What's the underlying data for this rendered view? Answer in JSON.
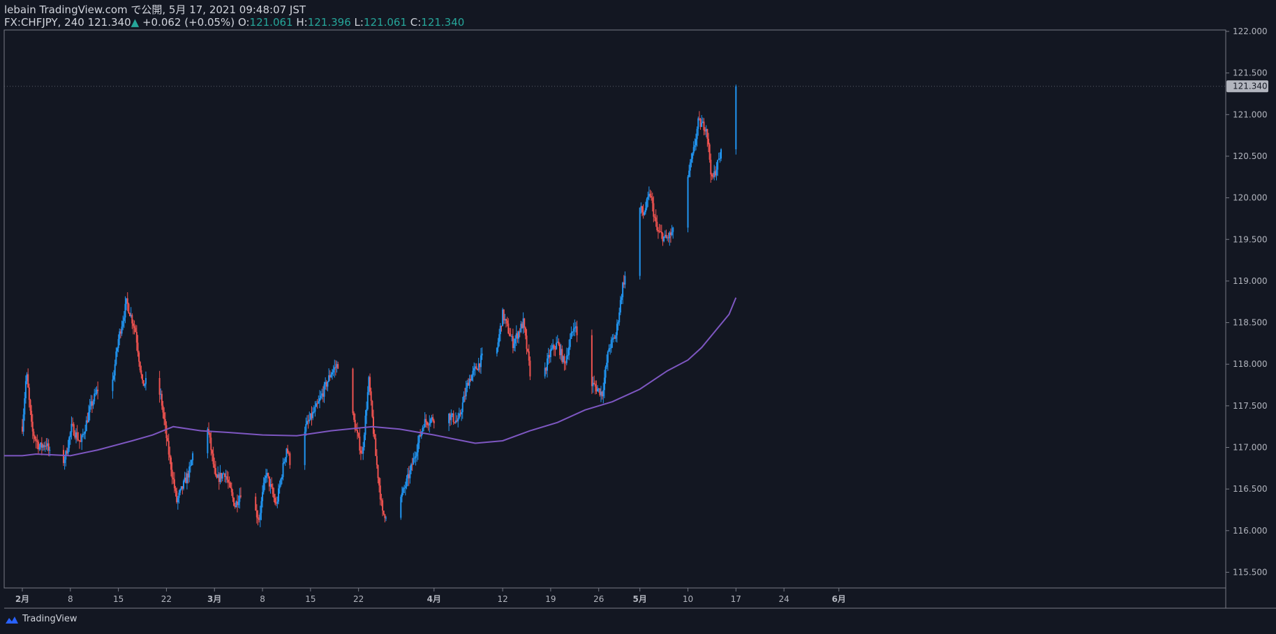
{
  "header": {
    "publish_line": "lebain TradingView.com で公開, 5月 17, 2021 09:48:07 JST",
    "symbol": "FX:CHFJPY, 240",
    "last": "121.340",
    "arrow": "▲",
    "change": "+0.062 (+0.05%)",
    "o_label": "O:",
    "o_value": "121.061",
    "h_label": "H:",
    "h_value": "121.396",
    "l_label": "L:",
    "l_value": "121.061",
    "c_label": "C:",
    "c_value": "121.340"
  },
  "footer": {
    "brand": "TradingView"
  },
  "colors": {
    "background": "#131722",
    "up": "#2196f3",
    "down": "#ef5350",
    "ma": "#7e57c2",
    "axis_text": "#b2b5be",
    "border": "#787b86",
    "price_tag_bg": "#b2b5be"
  },
  "chart_data": {
    "type": "candlestick",
    "symbol": "FX:CHFJPY",
    "interval": "240",
    "ylim": [
      115.35,
      122.1
    ],
    "price_ticks": [
      115.5,
      116.0,
      116.5,
      117.0,
      117.5,
      118.0,
      118.5,
      119.0,
      119.5,
      120.0,
      120.5,
      121.0,
      121.5,
      122.0
    ],
    "price_tick_labels": [
      "115.500",
      "116.000",
      "116.500",
      "117.000",
      "117.500",
      "118.000",
      "118.500",
      "119.000",
      "119.500",
      "120.000",
      "120.500",
      "121.000",
      "121.500",
      "122.000"
    ],
    "current_price": 121.34,
    "current_price_label": "121.340",
    "x_ticks": [
      {
        "label": "2月",
        "day": 0,
        "bold": true
      },
      {
        "label": "8",
        "day": 7
      },
      {
        "label": "15",
        "day": 14
      },
      {
        "label": "22",
        "day": 21
      },
      {
        "label": "3月",
        "day": 28,
        "bold": true
      },
      {
        "label": "8",
        "day": 35
      },
      {
        "label": "15",
        "day": 42
      },
      {
        "label": "22",
        "day": 49
      },
      {
        "label": "4月",
        "day": 60,
        "bold": true
      },
      {
        "label": "12",
        "day": 70
      },
      {
        "label": "19",
        "day": 77
      },
      {
        "label": "26",
        "day": 84
      },
      {
        "label": "5月",
        "day": 90,
        "bold": true
      },
      {
        "label": "10",
        "day": 97
      },
      {
        "label": "17",
        "day": 104
      },
      {
        "label": "24",
        "day": 111
      },
      {
        "label": "6月",
        "day": 119,
        "bold": true
      }
    ],
    "close_path": [
      {
        "day": 0,
        "price": 117.25
      },
      {
        "day": 0.6,
        "price": 117.9
      },
      {
        "day": 1.4,
        "price": 117.2
      },
      {
        "day": 2.5,
        "price": 117.0
      },
      {
        "day": 3.5,
        "price": 117.05
      },
      {
        "day": 5,
        "price": 116.65
      },
      {
        "day": 6.3,
        "price": 116.9
      },
      {
        "day": 7.2,
        "price": 117.25
      },
      {
        "day": 8.5,
        "price": 117.05
      },
      {
        "day": 10,
        "price": 117.5
      },
      {
        "day": 11.5,
        "price": 117.8
      },
      {
        "day": 13,
        "price": 117.7
      },
      {
        "day": 14,
        "price": 118.3
      },
      {
        "day": 15.2,
        "price": 118.75
      },
      {
        "day": 16.5,
        "price": 118.4
      },
      {
        "day": 17.5,
        "price": 117.75
      },
      {
        "day": 19,
        "price": 117.85
      },
      {
        "day": 20.2,
        "price": 117.6
      },
      {
        "day": 21.2,
        "price": 117.0
      },
      {
        "day": 22.5,
        "price": 116.35
      },
      {
        "day": 24.5,
        "price": 116.75
      },
      {
        "day": 26,
        "price": 117.5
      },
      {
        "day": 27,
        "price": 117.25
      },
      {
        "day": 28.2,
        "price": 116.6
      },
      {
        "day": 29.5,
        "price": 116.7
      },
      {
        "day": 31,
        "price": 116.3
      },
      {
        "day": 32.5,
        "price": 116.6
      },
      {
        "day": 33.5,
        "price": 116.3
      },
      {
        "day": 34.5,
        "price": 116.15
      },
      {
        "day": 35.5,
        "price": 116.7
      },
      {
        "day": 37,
        "price": 116.3
      },
      {
        "day": 38.5,
        "price": 117.0
      },
      {
        "day": 40,
        "price": 116.5
      },
      {
        "day": 41,
        "price": 117.2
      },
      {
        "day": 43,
        "price": 117.5
      },
      {
        "day": 45,
        "price": 117.9
      },
      {
        "day": 46.5,
        "price": 118.05
      },
      {
        "day": 47.8,
        "price": 117.5
      },
      {
        "day": 49.5,
        "price": 116.9
      },
      {
        "day": 50.5,
        "price": 117.8
      },
      {
        "day": 51.5,
        "price": 116.9
      },
      {
        "day": 52.5,
        "price": 116.2
      },
      {
        "day": 53.5,
        "price": 116.2
      },
      {
        "day": 55,
        "price": 116.35
      },
      {
        "day": 56.5,
        "price": 116.7
      },
      {
        "day": 58.5,
        "price": 117.3
      },
      {
        "day": 60,
        "price": 117.35
      },
      {
        "day": 60.8,
        "price": 117.05
      },
      {
        "day": 62,
        "price": 117.4
      },
      {
        "day": 63.5,
        "price": 117.3
      },
      {
        "day": 65,
        "price": 117.8
      },
      {
        "day": 66.5,
        "price": 118.0
      },
      {
        "day": 67.5,
        "price": 118.15
      },
      {
        "day": 68.5,
        "price": 117.85
      },
      {
        "day": 70,
        "price": 118.6
      },
      {
        "day": 71.5,
        "price": 118.25
      },
      {
        "day": 73,
        "price": 118.5
      },
      {
        "day": 74,
        "price": 117.9
      },
      {
        "day": 75.5,
        "price": 117.75
      },
      {
        "day": 77,
        "price": 118.15
      },
      {
        "day": 78,
        "price": 118.25
      },
      {
        "day": 79,
        "price": 118.0
      },
      {
        "day": 80.5,
        "price": 118.5
      },
      {
        "day": 82,
        "price": 117.8
      },
      {
        "day": 83.2,
        "price": 117.75
      },
      {
        "day": 84.5,
        "price": 117.65
      },
      {
        "day": 85.5,
        "price": 118.2
      },
      {
        "day": 86.5,
        "price": 118.35
      },
      {
        "day": 87.5,
        "price": 118.95
      },
      {
        "day": 88.5,
        "price": 119.25
      },
      {
        "day": 89.5,
        "price": 119.95
      },
      {
        "day": 90.5,
        "price": 119.8
      },
      {
        "day": 91.5,
        "price": 120.05
      },
      {
        "day": 92.5,
        "price": 119.6
      },
      {
        "day": 93.8,
        "price": 119.5
      },
      {
        "day": 95,
        "price": 119.6
      },
      {
        "day": 95.8,
        "price": 119.95
      },
      {
        "day": 96.8,
        "price": 120.2
      },
      {
        "day": 97.7,
        "price": 120.5
      },
      {
        "day": 98.5,
        "price": 120.9
      },
      {
        "day": 99.7,
        "price": 120.85
      },
      {
        "day": 100.5,
        "price": 120.2
      },
      {
        "day": 101.5,
        "price": 120.45
      },
      {
        "day": 102.5,
        "price": 120.7
      },
      {
        "day": 103.5,
        "price": 120.95
      },
      {
        "day": 104,
        "price": 121.34
      }
    ],
    "ma_path": [
      {
        "day": 0,
        "price": 116.9
      },
      {
        "day": 2,
        "price": 116.92
      },
      {
        "day": 7,
        "price": 116.9
      },
      {
        "day": 11,
        "price": 116.97
      },
      {
        "day": 16,
        "price": 117.08
      },
      {
        "day": 19,
        "price": 117.15
      },
      {
        "day": 22,
        "price": 117.25
      },
      {
        "day": 26,
        "price": 117.2
      },
      {
        "day": 30,
        "price": 117.18
      },
      {
        "day": 35,
        "price": 117.15
      },
      {
        "day": 40,
        "price": 117.14
      },
      {
        "day": 45,
        "price": 117.2
      },
      {
        "day": 51,
        "price": 117.25
      },
      {
        "day": 55,
        "price": 117.22
      },
      {
        "day": 60,
        "price": 117.15
      },
      {
        "day": 63,
        "price": 117.1
      },
      {
        "day": 66,
        "price": 117.05
      },
      {
        "day": 70,
        "price": 117.08
      },
      {
        "day": 74,
        "price": 117.2
      },
      {
        "day": 78,
        "price": 117.3
      },
      {
        "day": 82,
        "price": 117.45
      },
      {
        "day": 86,
        "price": 117.55
      },
      {
        "day": 90,
        "price": 117.7
      },
      {
        "day": 94,
        "price": 117.92
      },
      {
        "day": 97,
        "price": 118.05
      },
      {
        "day": 99,
        "price": 118.2
      },
      {
        "day": 101,
        "price": 118.4
      },
      {
        "day": 103,
        "price": 118.6
      },
      {
        "day": 104,
        "price": 118.8
      }
    ]
  }
}
